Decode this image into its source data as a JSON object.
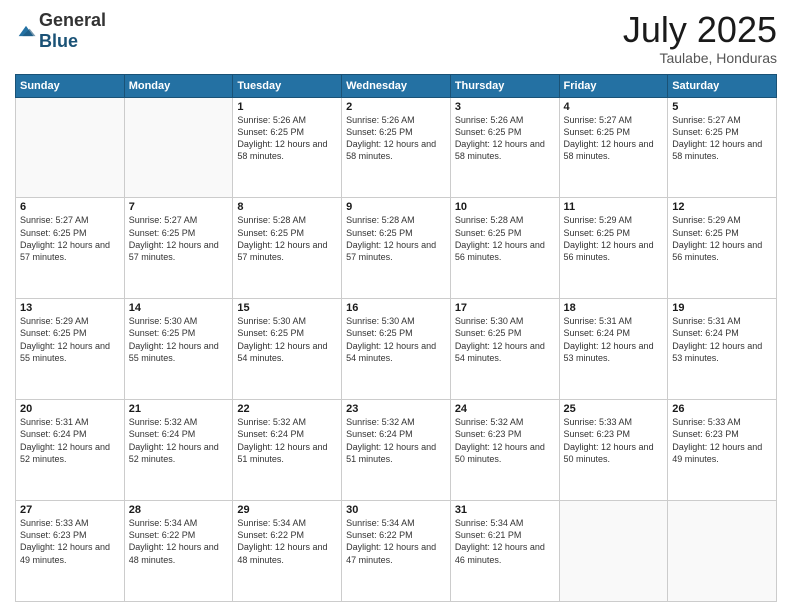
{
  "header": {
    "logo_general": "General",
    "logo_blue": "Blue",
    "month_year": "July 2025",
    "location": "Taulabe, Honduras"
  },
  "days_of_week": [
    "Sunday",
    "Monday",
    "Tuesday",
    "Wednesday",
    "Thursday",
    "Friday",
    "Saturday"
  ],
  "weeks": [
    [
      {
        "day": "",
        "sunrise": "",
        "sunset": "",
        "daylight": ""
      },
      {
        "day": "",
        "sunrise": "",
        "sunset": "",
        "daylight": ""
      },
      {
        "day": "1",
        "sunrise": "Sunrise: 5:26 AM",
        "sunset": "Sunset: 6:25 PM",
        "daylight": "Daylight: 12 hours and 58 minutes."
      },
      {
        "day": "2",
        "sunrise": "Sunrise: 5:26 AM",
        "sunset": "Sunset: 6:25 PM",
        "daylight": "Daylight: 12 hours and 58 minutes."
      },
      {
        "day": "3",
        "sunrise": "Sunrise: 5:26 AM",
        "sunset": "Sunset: 6:25 PM",
        "daylight": "Daylight: 12 hours and 58 minutes."
      },
      {
        "day": "4",
        "sunrise": "Sunrise: 5:27 AM",
        "sunset": "Sunset: 6:25 PM",
        "daylight": "Daylight: 12 hours and 58 minutes."
      },
      {
        "day": "5",
        "sunrise": "Sunrise: 5:27 AM",
        "sunset": "Sunset: 6:25 PM",
        "daylight": "Daylight: 12 hours and 58 minutes."
      }
    ],
    [
      {
        "day": "6",
        "sunrise": "Sunrise: 5:27 AM",
        "sunset": "Sunset: 6:25 PM",
        "daylight": "Daylight: 12 hours and 57 minutes."
      },
      {
        "day": "7",
        "sunrise": "Sunrise: 5:27 AM",
        "sunset": "Sunset: 6:25 PM",
        "daylight": "Daylight: 12 hours and 57 minutes."
      },
      {
        "day": "8",
        "sunrise": "Sunrise: 5:28 AM",
        "sunset": "Sunset: 6:25 PM",
        "daylight": "Daylight: 12 hours and 57 minutes."
      },
      {
        "day": "9",
        "sunrise": "Sunrise: 5:28 AM",
        "sunset": "Sunset: 6:25 PM",
        "daylight": "Daylight: 12 hours and 57 minutes."
      },
      {
        "day": "10",
        "sunrise": "Sunrise: 5:28 AM",
        "sunset": "Sunset: 6:25 PM",
        "daylight": "Daylight: 12 hours and 56 minutes."
      },
      {
        "day": "11",
        "sunrise": "Sunrise: 5:29 AM",
        "sunset": "Sunset: 6:25 PM",
        "daylight": "Daylight: 12 hours and 56 minutes."
      },
      {
        "day": "12",
        "sunrise": "Sunrise: 5:29 AM",
        "sunset": "Sunset: 6:25 PM",
        "daylight": "Daylight: 12 hours and 56 minutes."
      }
    ],
    [
      {
        "day": "13",
        "sunrise": "Sunrise: 5:29 AM",
        "sunset": "Sunset: 6:25 PM",
        "daylight": "Daylight: 12 hours and 55 minutes."
      },
      {
        "day": "14",
        "sunrise": "Sunrise: 5:30 AM",
        "sunset": "Sunset: 6:25 PM",
        "daylight": "Daylight: 12 hours and 55 minutes."
      },
      {
        "day": "15",
        "sunrise": "Sunrise: 5:30 AM",
        "sunset": "Sunset: 6:25 PM",
        "daylight": "Daylight: 12 hours and 54 minutes."
      },
      {
        "day": "16",
        "sunrise": "Sunrise: 5:30 AM",
        "sunset": "Sunset: 6:25 PM",
        "daylight": "Daylight: 12 hours and 54 minutes."
      },
      {
        "day": "17",
        "sunrise": "Sunrise: 5:30 AM",
        "sunset": "Sunset: 6:25 PM",
        "daylight": "Daylight: 12 hours and 54 minutes."
      },
      {
        "day": "18",
        "sunrise": "Sunrise: 5:31 AM",
        "sunset": "Sunset: 6:24 PM",
        "daylight": "Daylight: 12 hours and 53 minutes."
      },
      {
        "day": "19",
        "sunrise": "Sunrise: 5:31 AM",
        "sunset": "Sunset: 6:24 PM",
        "daylight": "Daylight: 12 hours and 53 minutes."
      }
    ],
    [
      {
        "day": "20",
        "sunrise": "Sunrise: 5:31 AM",
        "sunset": "Sunset: 6:24 PM",
        "daylight": "Daylight: 12 hours and 52 minutes."
      },
      {
        "day": "21",
        "sunrise": "Sunrise: 5:32 AM",
        "sunset": "Sunset: 6:24 PM",
        "daylight": "Daylight: 12 hours and 52 minutes."
      },
      {
        "day": "22",
        "sunrise": "Sunrise: 5:32 AM",
        "sunset": "Sunset: 6:24 PM",
        "daylight": "Daylight: 12 hours and 51 minutes."
      },
      {
        "day": "23",
        "sunrise": "Sunrise: 5:32 AM",
        "sunset": "Sunset: 6:24 PM",
        "daylight": "Daylight: 12 hours and 51 minutes."
      },
      {
        "day": "24",
        "sunrise": "Sunrise: 5:32 AM",
        "sunset": "Sunset: 6:23 PM",
        "daylight": "Daylight: 12 hours and 50 minutes."
      },
      {
        "day": "25",
        "sunrise": "Sunrise: 5:33 AM",
        "sunset": "Sunset: 6:23 PM",
        "daylight": "Daylight: 12 hours and 50 minutes."
      },
      {
        "day": "26",
        "sunrise": "Sunrise: 5:33 AM",
        "sunset": "Sunset: 6:23 PM",
        "daylight": "Daylight: 12 hours and 49 minutes."
      }
    ],
    [
      {
        "day": "27",
        "sunrise": "Sunrise: 5:33 AM",
        "sunset": "Sunset: 6:23 PM",
        "daylight": "Daylight: 12 hours and 49 minutes."
      },
      {
        "day": "28",
        "sunrise": "Sunrise: 5:34 AM",
        "sunset": "Sunset: 6:22 PM",
        "daylight": "Daylight: 12 hours and 48 minutes."
      },
      {
        "day": "29",
        "sunrise": "Sunrise: 5:34 AM",
        "sunset": "Sunset: 6:22 PM",
        "daylight": "Daylight: 12 hours and 48 minutes."
      },
      {
        "day": "30",
        "sunrise": "Sunrise: 5:34 AM",
        "sunset": "Sunset: 6:22 PM",
        "daylight": "Daylight: 12 hours and 47 minutes."
      },
      {
        "day": "31",
        "sunrise": "Sunrise: 5:34 AM",
        "sunset": "Sunset: 6:21 PM",
        "daylight": "Daylight: 12 hours and 46 minutes."
      },
      {
        "day": "",
        "sunrise": "",
        "sunset": "",
        "daylight": ""
      },
      {
        "day": "",
        "sunrise": "",
        "sunset": "",
        "daylight": ""
      }
    ]
  ]
}
